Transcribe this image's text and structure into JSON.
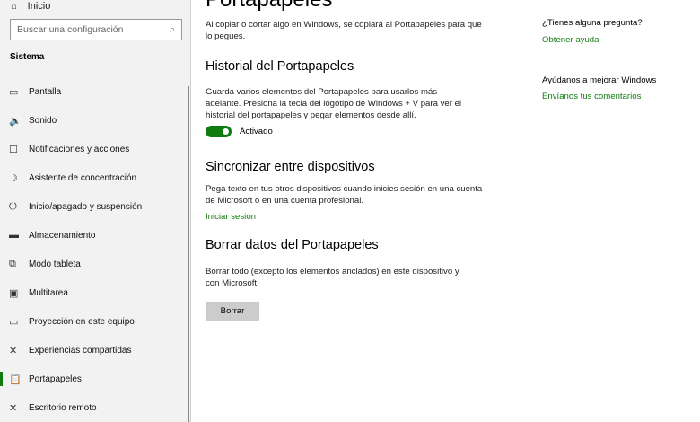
{
  "sidebar": {
    "home": "Inicio",
    "search_placeholder": "Buscar una configuración",
    "section": "Sistema",
    "items": [
      {
        "label": "Pantalla",
        "icon": "▭"
      },
      {
        "label": "Sonido",
        "icon": "🔈"
      },
      {
        "label": "Notificaciones y acciones",
        "icon": "☐"
      },
      {
        "label": "Asistente de concentración",
        "icon": "☽"
      },
      {
        "label": "Inicio/apagado y suspensión",
        "icon": "⏻"
      },
      {
        "label": "Almacenamiento",
        "icon": "▬"
      },
      {
        "label": "Modo tableta",
        "icon": "⧉"
      },
      {
        "label": "Multitarea",
        "icon": "▣"
      },
      {
        "label": "Proyección en este equipo",
        "icon": "▭"
      },
      {
        "label": "Experiencias compartidas",
        "icon": "✕"
      },
      {
        "label": "Portapapeles",
        "icon": "📋"
      },
      {
        "label": "Escritorio remoto",
        "icon": "✕"
      }
    ],
    "selected": "Portapapeles"
  },
  "main": {
    "title": "Portapapeles",
    "intro": "Al copiar o cortar algo en Windows, se copiará al Portapapeles para que lo pegues.",
    "history": {
      "heading": "Historial del Portapapeles",
      "desc": "Guarda varios elementos del Portapapeles para usarlos más adelante. Presiona la tecla del logotipo de Windows + V para ver el historial del portapapeles y pegar elementos desde allí.",
      "toggle_label": "Activado",
      "toggle_on": true
    },
    "sync": {
      "heading": "Sincronizar entre dispositivos",
      "desc": "Pega texto en tus otros dispositivos cuando inicies sesión en una cuenta de Microsoft o en una cuenta profesional.",
      "link": "Iniciar sesión"
    },
    "clear": {
      "heading": "Borrar datos del Portapapeles",
      "desc": "Borrar todo (excepto los elementos anclados) en este dispositivo y con Microsoft.",
      "button": "Borrar"
    }
  },
  "aside": {
    "question": "¿Tienes alguna pregunta?",
    "help": "Obtener ayuda",
    "improve": "Ayúdanos a mejorar Windows",
    "feedback": "Envíanos tus comentarios"
  },
  "colors": {
    "accent": "#107c10"
  }
}
